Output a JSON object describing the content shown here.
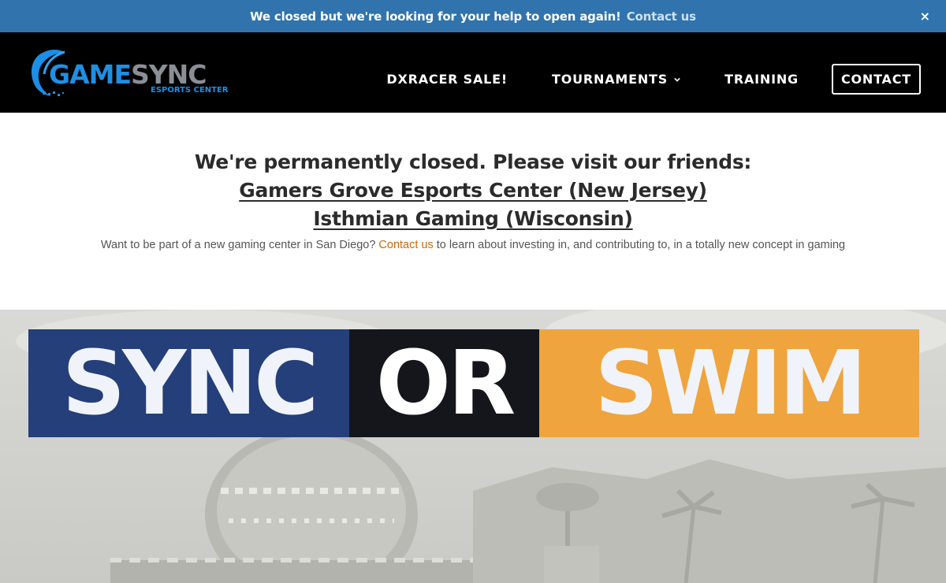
{
  "announcement": {
    "message": "We closed but we're looking for your help to open again!",
    "link_label": "Contact us",
    "close_label": "×"
  },
  "header": {
    "logo": {
      "brand_part1": "GAME",
      "brand_part2": "SYNC",
      "tagline": "ESPORTS CENTER"
    },
    "nav": {
      "sale_label": "DXRACER SALE!",
      "tournaments_label": "TOURNAMENTS",
      "training_label": "TRAINING",
      "contact_label": "CONTACT"
    }
  },
  "notice": {
    "heading": "We're permanently closed. Please visit our friends:",
    "friend1": "Gamers Grove Esports Center (New Jersey)",
    "friend2": "Isthmian Gaming (Wisconsin)",
    "text_before": "Want to be part of a new gaming center in San Diego? ",
    "contact_link": "Contact us",
    "text_after": " to learn about investing in, and contributing to, in a totally new concept in gaming"
  },
  "hero": {
    "banner": {
      "word1": "SYNC",
      "word2": "OR",
      "word3": "SWIM"
    }
  },
  "colors": {
    "announcement_bg": "#3073ad",
    "header_bg": "#000000",
    "accent_link": "#c96a10",
    "banner_blue": "#243f7a",
    "banner_dark": "#14161c",
    "banner_orange": "#f0a43e"
  }
}
